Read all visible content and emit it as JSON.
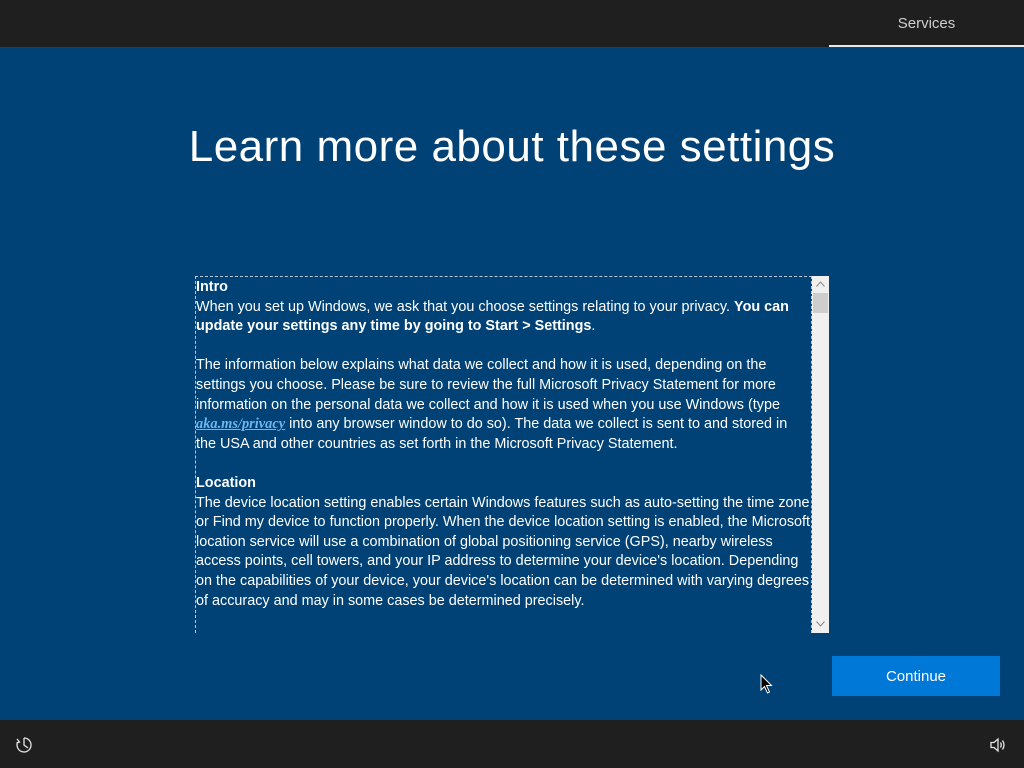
{
  "top_tab": {
    "label": "Services"
  },
  "title": "Learn more about these settings",
  "content": {
    "intro": {
      "heading": "Intro",
      "p1_text": "When you set up Windows, we ask that you choose settings relating to your privacy. ",
      "p1_bold": "You can update your settings any time by going to Start > Settings",
      "p1_end": ".",
      "p2_before": "The information below explains what data we collect and how it is used, depending on the settings you choose. Please be sure to review the full Microsoft Privacy Statement for more information on the personal data we collect and how it is used when you use Windows (type ",
      "p2_link": "aka.ms/privacy",
      "p2_after": " into any browser window to do so). The data we collect is sent to and stored in the USA and other countries as set forth in the Microsoft Privacy Statement."
    },
    "location": {
      "heading": "Location",
      "p1": "The device location setting enables certain Windows features such as auto-setting the time zone or Find my device to function properly. When the device location setting is enabled, the Microsoft location service will use a combination of global positioning service (GPS), nearby wireless access points, cell towers, and your IP address to determine your device's location. Depending on the capabilities of your device, your device's location can be determined with varying degrees of accuracy and may in some cases be determined precisely."
    }
  },
  "continue_button": {
    "label": "Continue"
  },
  "icons": {
    "accessibility": "ease-of-access-icon",
    "volume": "volume-icon"
  },
  "colors": {
    "background": "#004275",
    "bar": "#1f1f1f",
    "accent": "#0078d7",
    "link": "#6fb6f0"
  }
}
